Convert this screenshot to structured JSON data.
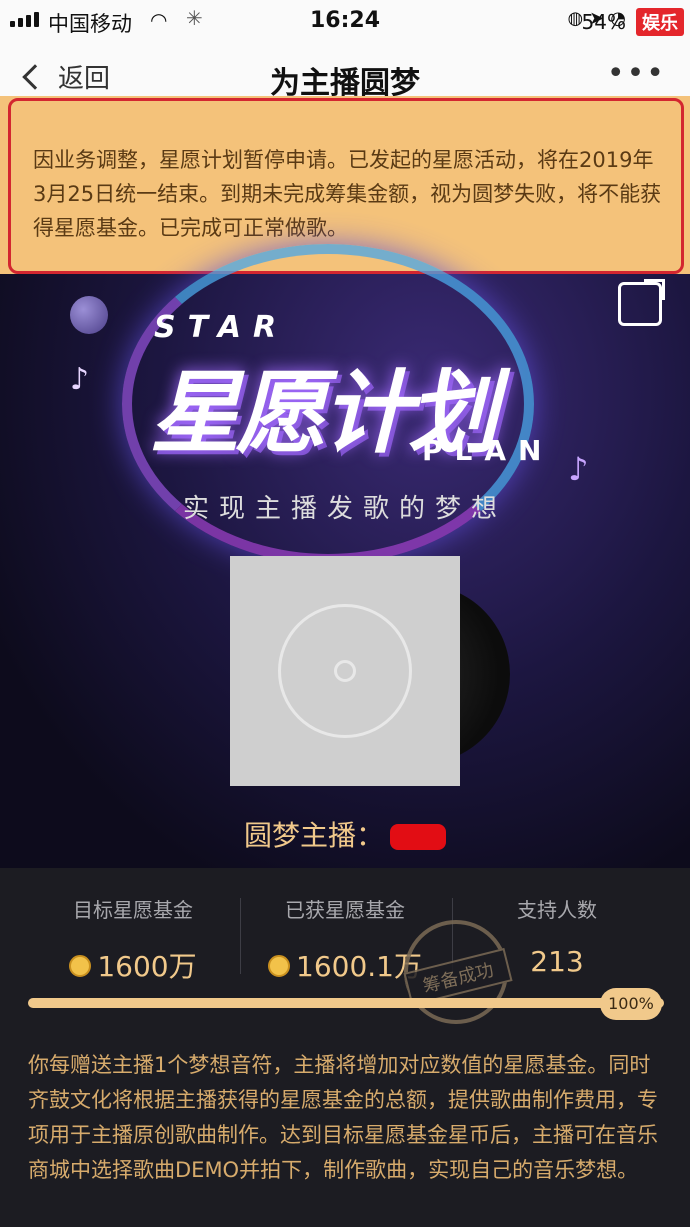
{
  "status_bar": {
    "carrier": "中国移动",
    "time": "16:24",
    "battery": "54%",
    "watermark": "娱乐"
  },
  "nav": {
    "back_label": "返回",
    "title": "为主播圆梦",
    "more_label": "•••"
  },
  "notice": {
    "text": "因业务调整，星愿计划暂停申请。已发起的星愿活动，将在2019年3月25日统一结束。到期未完成筹集金额，视为圆梦失败，将不能获得星愿基金。已完成可正常做歌。"
  },
  "hero": {
    "star_text": "STAR",
    "title": "星愿计划",
    "plan_text": "PLAN",
    "subtitle": "实现主播发歌的梦想",
    "host_label": "圆梦主播："
  },
  "stats": {
    "target_label": "目标星愿基金",
    "target_value": "1600万",
    "received_label": "已获星愿基金",
    "received_value": "1600.1万",
    "supporters_label": "支持人数",
    "supporters_value": "213",
    "stamp_text": "筹备成功",
    "progress_fraction": 1.0,
    "progress_text": "100%"
  },
  "description": "你每赠送主播1个梦想音符，主播将增加对应数值的星愿基金。同时齐鼓文化将根据主播获得的星愿基金的总额，提供歌曲制作费用，专项用于主播原创歌曲制作。达到目标星愿基金星币后，主播可在音乐商城中选择歌曲DEMO并拍下，制作歌曲，实现自己的音乐梦想。"
}
